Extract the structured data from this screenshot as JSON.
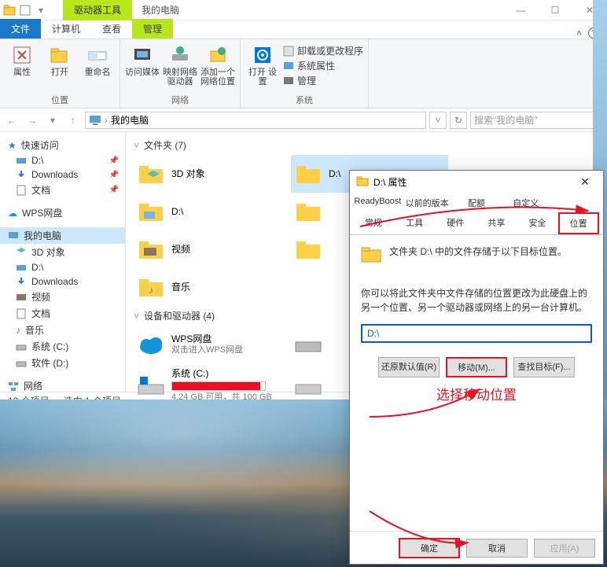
{
  "titlebar": {
    "drive_tool": "驱动器工具",
    "title": "我的电脑"
  },
  "ribbon_tabs": {
    "file": "文件",
    "computer": "计算机",
    "view": "查看",
    "manage": "管理"
  },
  "ribbon": {
    "group_location": "位置",
    "group_network": "网络",
    "group_system": "系统",
    "btn_properties": "属性",
    "btn_open": "打开",
    "btn_rename": "重命名",
    "btn_media": "访问媒体",
    "btn_mapnet": "映射网络\n驱动器",
    "btn_addnet": "添加一个\n网络位置",
    "btn_opensettings": "打开\n设置",
    "sys_uninstall": "卸载或更改程序",
    "sys_props": "系统属性",
    "sys_manage": "管理"
  },
  "nav": {
    "breadcrumb": "我的电脑",
    "search_placeholder": "搜索\"我的电脑\""
  },
  "sidebar": {
    "quick": "快速访问",
    "d": "D:\\",
    "downloads": "Downloads",
    "docs": "文档",
    "wps": "WPS网盘",
    "thispc": "我的电脑",
    "obj3d": "3D 对象",
    "d2": "D:\\",
    "downloads2": "Downloads",
    "videos": "视频",
    "docs2": "文档",
    "music": "音乐",
    "sysc": "系统 (C:)",
    "softd": "软件 (D:)",
    "network": "网络"
  },
  "content": {
    "folders_header": "文件夹 (7)",
    "drives_header": "设备和驱动器 (4)",
    "items": {
      "obj3d": "3D 对象",
      "d": "D:\\",
      "d2": "D:\\",
      "videos": "视频",
      "music": "音乐"
    },
    "wps": {
      "name": "WPS网盘",
      "sub": "双击进入WPS网盘"
    },
    "sysc": {
      "name": "系统 (C:)",
      "sub": "4.24 GB 可用，共 100 GB",
      "fill_pct": 95
    }
  },
  "status": {
    "count": "12 个项目",
    "sel": "选中 1 个项目"
  },
  "dialog": {
    "title": "D:\\ 属性",
    "tabs": {
      "readyboost": "ReadyBoost",
      "prev": "以前的版本",
      "quota": "配额",
      "custom": "自定义",
      "general": "常规",
      "tools": "工具",
      "hardware": "硬件",
      "sharing": "共享",
      "security": "安全",
      "location": "位置"
    },
    "loc_text": "文件夹 D:\\ 中的文件存储于以下目标位置。",
    "desc": "你可以将此文件夹中文件存储的位置更改为此硬盘上的另一个位置、另一个驱动器或网络上的另一台计算机。",
    "path_value": "D:\\",
    "btn_restore": "还原默认值(R)",
    "btn_move": "移动(M)...",
    "btn_find": "查找目标(F)...",
    "annotation": "选择移动位置",
    "ok": "确定",
    "cancel": "取消",
    "apply": "应用(A)"
  }
}
